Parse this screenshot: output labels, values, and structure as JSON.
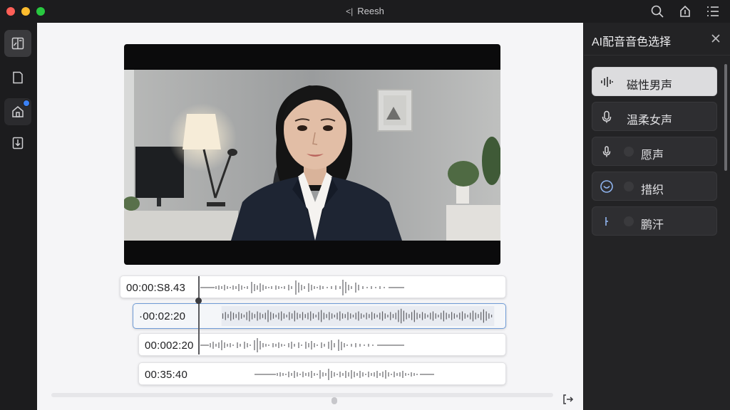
{
  "window": {
    "title": "Reesh",
    "logo_glyph": "<|"
  },
  "colors": {
    "accent": "#3b82f6",
    "selected_voice_bg": "#dcdcde",
    "panel_bg": "#232325",
    "canvas_bg": "#f5f5f7"
  },
  "titlebar_icons": [
    "search-icon",
    "share-icon",
    "list-icon"
  ],
  "sidebar": {
    "items": [
      {
        "name": "layout-icon",
        "state": "active"
      },
      {
        "name": "document-icon",
        "state": "normal"
      },
      {
        "name": "home-icon",
        "state": "soft",
        "badge": true
      },
      {
        "name": "download-icon",
        "state": "normal"
      }
    ]
  },
  "timeline": {
    "tracks": [
      {
        "time": "00:00:S8.43",
        "selected": false
      },
      {
        "time": "·00:02:20",
        "selected": true
      },
      {
        "time": "00:002:20",
        "selected": false
      },
      {
        "time": "00:35:40",
        "selected": false
      }
    ]
  },
  "panel": {
    "title": "AI配音音色选择",
    "voices": [
      {
        "label": "磁性男声",
        "icon": "waveform-icon",
        "selected": true
      },
      {
        "label": "温柔女声",
        "icon": "microphone-icon",
        "selected": false
      },
      {
        "label": "愿声",
        "icon": "microphone-small-icon",
        "selected": false
      },
      {
        "label": "措织",
        "icon": "circle-check-icon",
        "selected": false
      },
      {
        "label": "鹏汗",
        "icon": "line-icon",
        "selected": false
      }
    ]
  }
}
